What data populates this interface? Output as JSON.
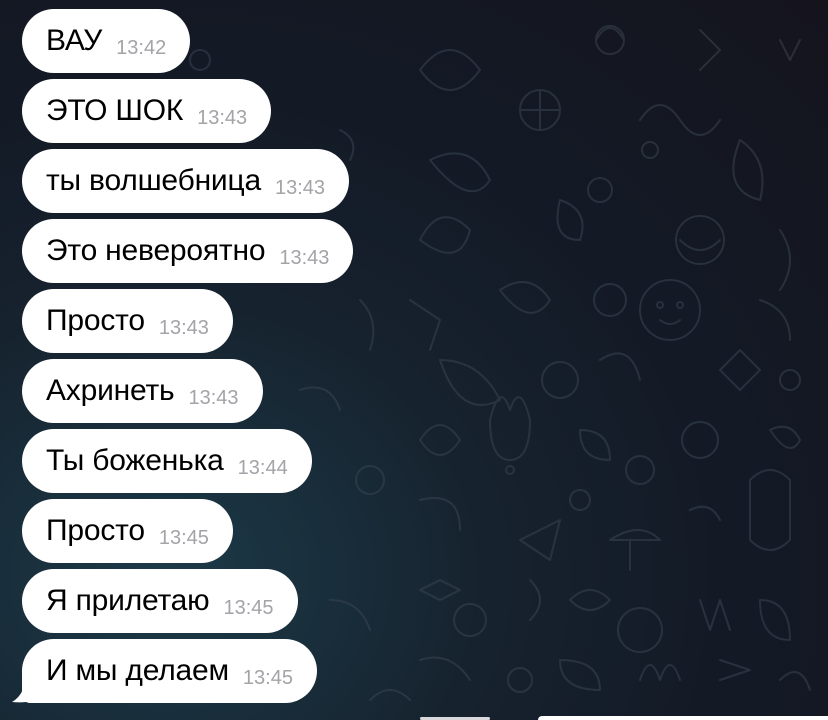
{
  "colors": {
    "bubble": "#ffffff",
    "text": "#000000",
    "time": "#a3a3a8",
    "background": "#141b26"
  },
  "messages": [
    {
      "text": "ВАУ",
      "time": "13:42"
    },
    {
      "text": "ЭТО ШОК",
      "time": "13:43"
    },
    {
      "text": "ты волшебница",
      "time": "13:43"
    },
    {
      "text": "Это невероятно",
      "time": "13:43"
    },
    {
      "text": "Просто",
      "time": "13:43"
    },
    {
      "text": "Ахринеть",
      "time": "13:43"
    },
    {
      "text": "Ты боженька",
      "time": "13:44"
    },
    {
      "text": "Просто",
      "time": "13:45"
    },
    {
      "text": "Я прилетаю",
      "time": "13:45"
    },
    {
      "text": "И мы делаем",
      "time": "13:45"
    }
  ]
}
